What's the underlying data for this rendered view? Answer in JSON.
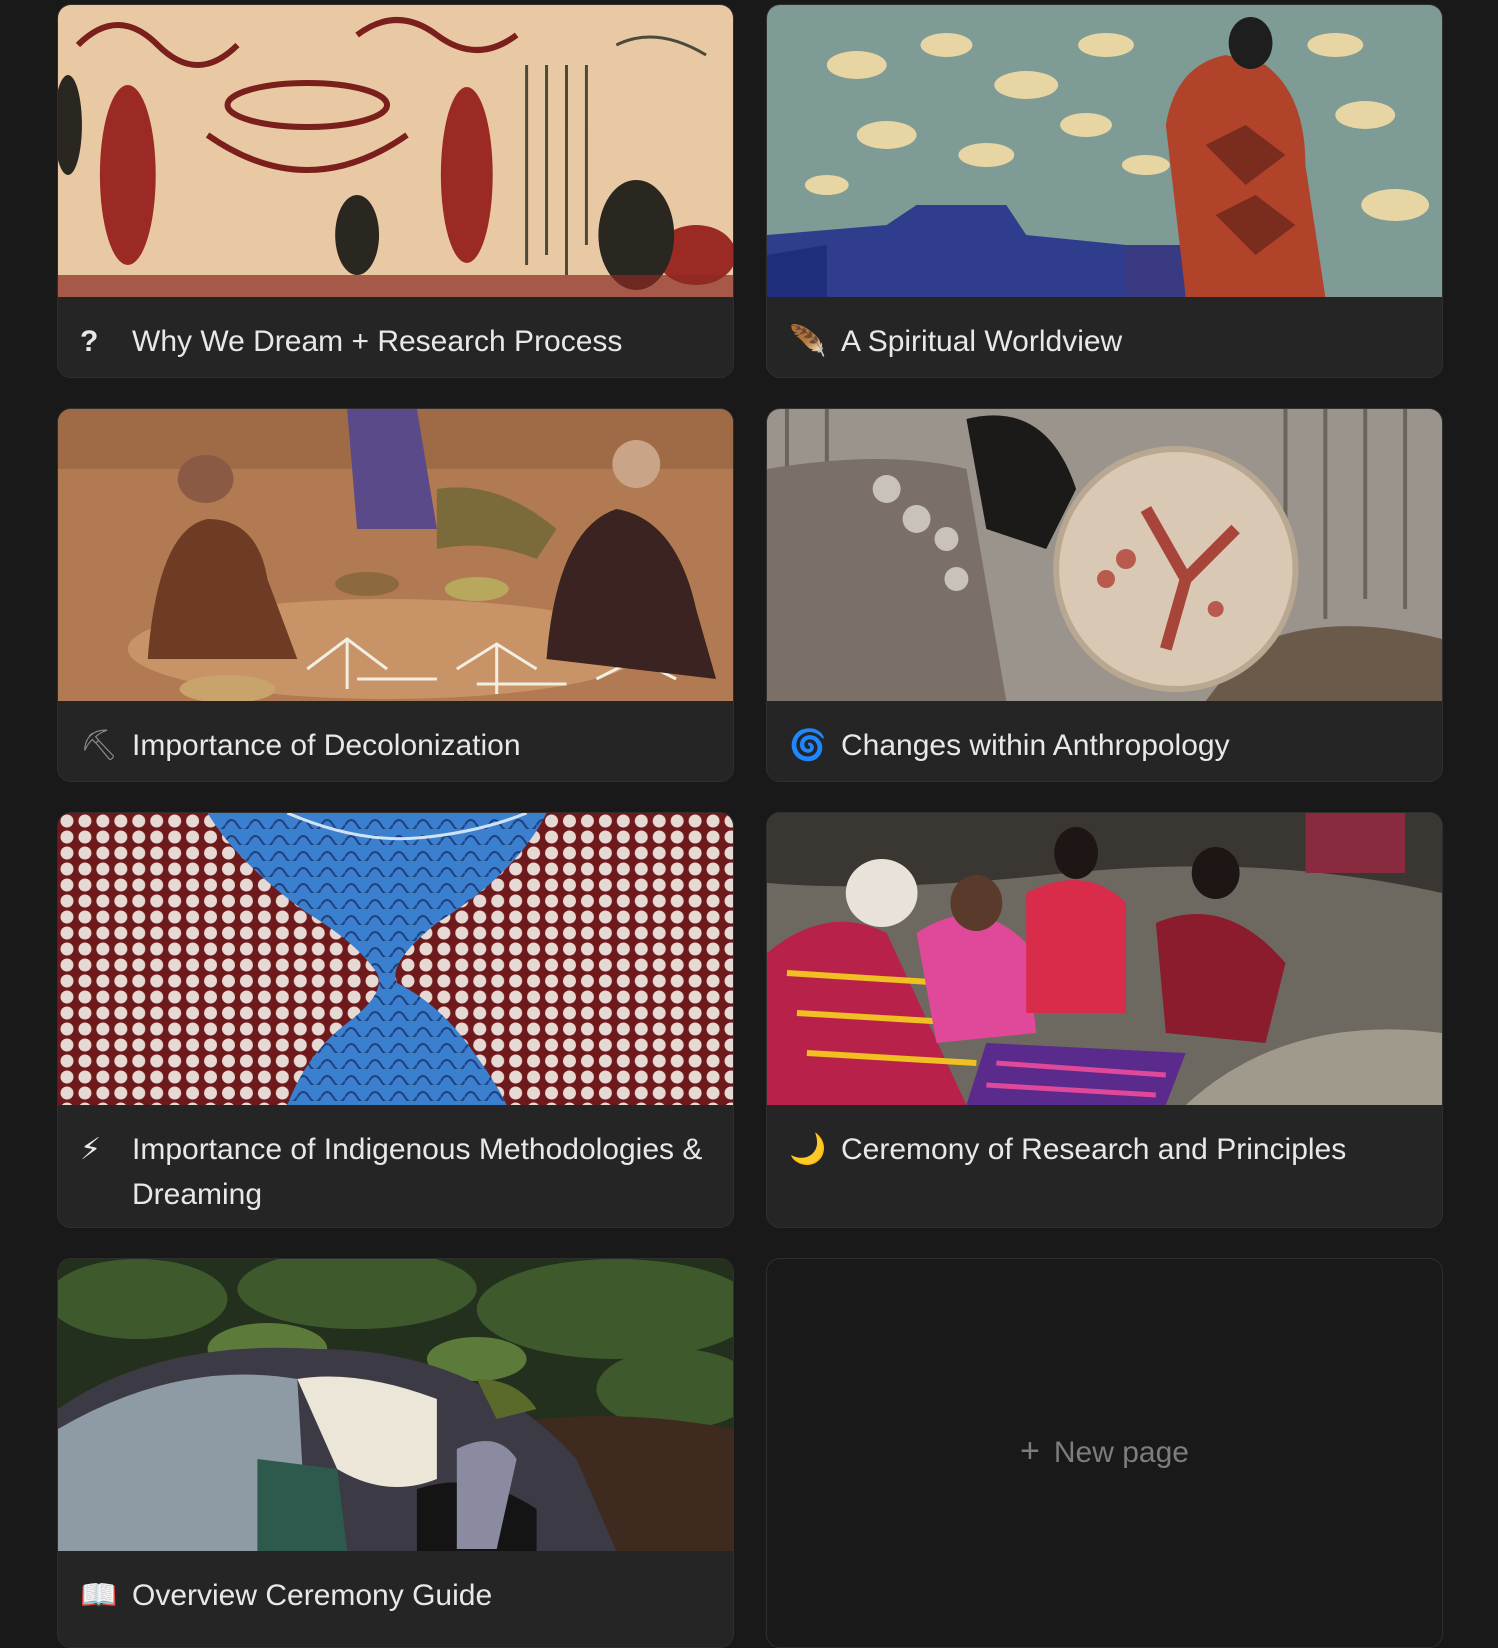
{
  "gallery": {
    "cards": [
      {
        "title": "Why We Dream + Research Process",
        "icon_name": "question-mark-icon",
        "icon": "?",
        "icon_color": "#e8e8e6"
      },
      {
        "title": "A Spiritual Worldview",
        "icon_name": "feather-icon",
        "icon": "🪶",
        "icon_color": "#c9c0b0"
      },
      {
        "title": "Importance of Decolonization",
        "icon_name": "pick-icon",
        "icon": "⛏",
        "icon_color": "#8a8a8a"
      },
      {
        "title": "Changes within Anthropology",
        "icon_name": "cyclone-icon",
        "icon": "🌀",
        "icon_color": "#3f7fe0"
      },
      {
        "title": "Importance of Indigenous Methodologies & Dreaming",
        "icon_name": "lightning-icon",
        "icon": "⚡",
        "icon_color": "#f5c518"
      },
      {
        "title": "Ceremony of Research and Principles",
        "icon_name": "crescent-moon-icon",
        "icon": "🌙",
        "icon_color": "#f5c518"
      },
      {
        "title": "Overview Ceremony Guide",
        "icon_name": "open-book-icon",
        "icon": "📖",
        "icon_color": "#d9d9d9"
      }
    ],
    "new_page": {
      "plus": "+",
      "label": "New page"
    }
  }
}
